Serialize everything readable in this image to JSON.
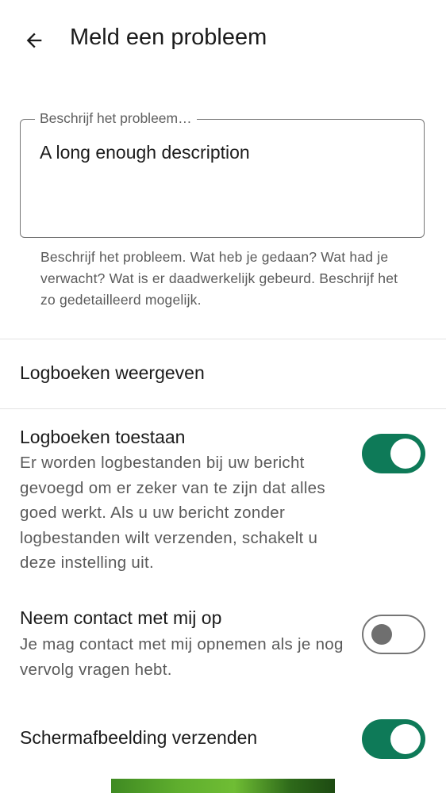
{
  "appbar": {
    "back_icon": "arrow-back-icon",
    "title": "Meld een probleem"
  },
  "description": {
    "label": "Beschrijf het probleem…",
    "value": "A long enough description",
    "helper": "Beschrijf het probleem. Wat heb je gedaan? Wat had je verwacht? Wat is er daadwerkelijk gebeurd. Beschrijf het zo gedetailleerd mogelijk."
  },
  "view_logs": {
    "label": "Logboeken weergeven"
  },
  "allow_logs": {
    "title": "Logboeken toestaan",
    "description": "Er worden logbestanden bij uw bericht gevoegd om er zeker van te zijn dat alles goed werkt. Als u uw bericht zonder logbestanden wilt verzenden, schakelt u deze instelling uit.",
    "enabled": true
  },
  "contact": {
    "title": "Neem contact met mij op",
    "description": "Je mag contact met mij opnemen als je nog vervolg vragen hebt.",
    "enabled": false
  },
  "send_screenshot": {
    "title": "Schermafbeelding verzenden",
    "enabled": true
  },
  "colors": {
    "accent": "#0e7a58",
    "text_primary": "#1b1b1b",
    "text_secondary": "#5a5a5a",
    "divider": "#e3e3e3"
  }
}
